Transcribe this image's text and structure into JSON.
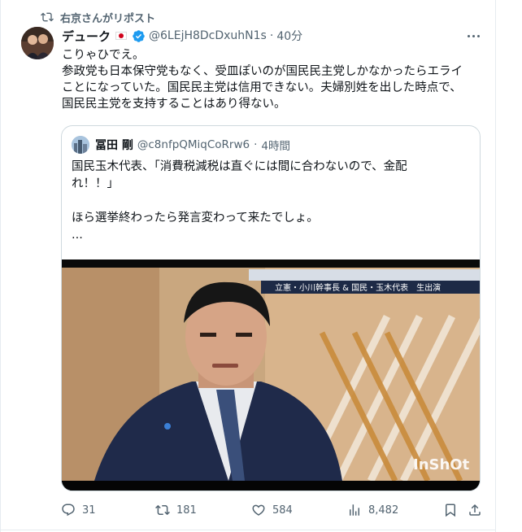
{
  "repost": {
    "label": "右京さんがリポスト"
  },
  "author": {
    "display_name": "デューク",
    "handle": "@6LEjH8DcDxuhN1s",
    "separator": "·",
    "time": "40分"
  },
  "post": {
    "lines": [
      "こりゃひでえ。",
      "参政党も日本保守党もなく、受皿ぽいのが国民民主党しかなかったらエライ",
      "ことになっていた。国民民主党は信用できない。夫婦別姓を出した時点で、",
      "国民民主党を支持することはあり得ない。"
    ]
  },
  "quote": {
    "display_name": "冨田 剛",
    "handle": "@c8nfpQMiqCoRrw6",
    "separator": "·",
    "time": "4時間",
    "lines": [
      "国民玉木代表、「消費税減税は直ぐには間に合わないので、金配",
      "れ！！」",
      "",
      "ほら選挙終わったら発言変わって来たでしょ。",
      "..."
    ],
    "media": {
      "caption": "立憲・小川幹事長 & 国民・玉木代表　生出演",
      "watermark": "InShOt"
    }
  },
  "metrics": {
    "replies": "31",
    "reposts": "181",
    "likes": "584",
    "views": "8,482"
  },
  "colors": {
    "text": "#0f1419",
    "secondary": "#536471",
    "border": "#cfd9de",
    "verified": "#1d9bf0"
  }
}
